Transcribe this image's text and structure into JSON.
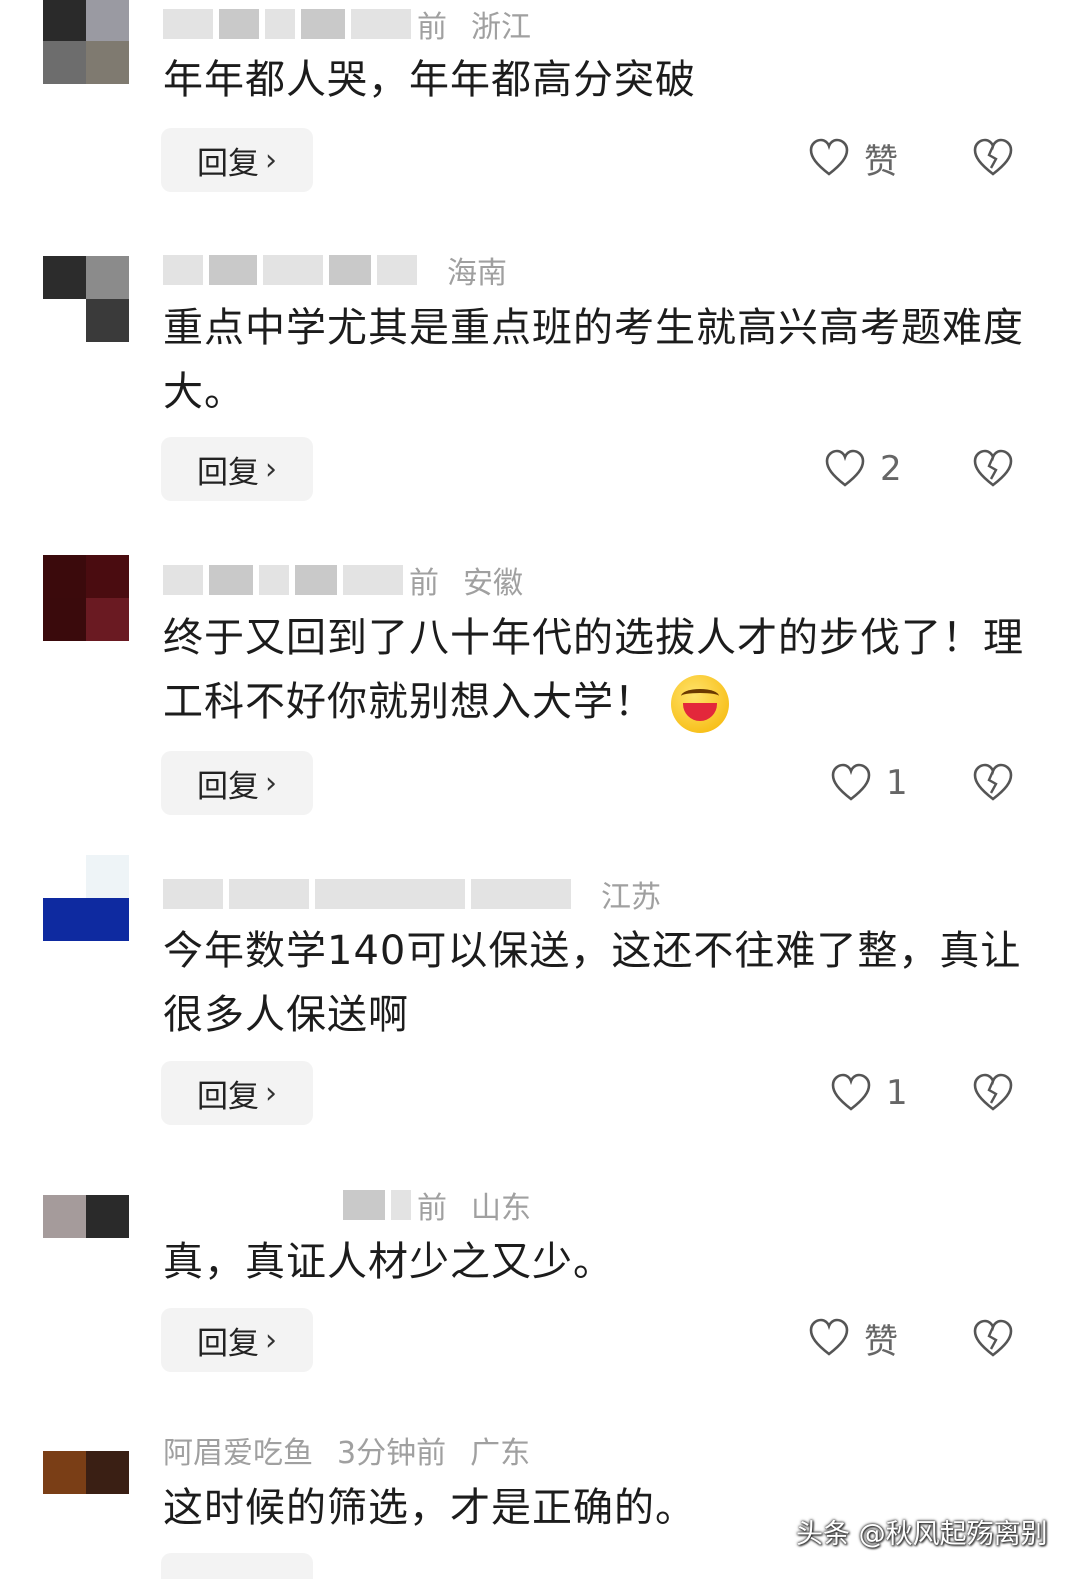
{
  "comments": [
    {
      "meta_tail": "前",
      "location": "浙江",
      "text": "年年都人哭，年年都高分突破",
      "reply_label": "回复",
      "like_label": "赞",
      "avatar_colors": [
        "#2a2a2a",
        "#9a9aa2",
        "#6d6d6d",
        "#7f7a70"
      ]
    },
    {
      "meta_tail": "",
      "location": "海南",
      "text": "重点中学尤其是重点班的考生就高兴高考题难度大。",
      "reply_label": "回复",
      "like_label": "2",
      "avatar_colors": [
        "#2c2c2c",
        "#8b8b8b",
        "#ffffff",
        "#3a3a3a"
      ]
    },
    {
      "meta_tail": "前",
      "location": "安徽",
      "text": "终于又回到了八十年代的选拔人才的步伐了！理工科不好你就别想入大学！",
      "reply_label": "回复",
      "like_label": "1",
      "avatar_colors": [
        "#3b0a0c",
        "#4a0c10",
        "#3a0a0c",
        "#6a1a22"
      ]
    },
    {
      "meta_tail": "",
      "location": "江苏",
      "text": "今年数学140可以保送，这还不往难了整，真让很多人保送啊",
      "reply_label": "回复",
      "like_label": "1",
      "avatar_colors": [
        "#ffffff",
        "#eef4f7",
        "#0e2aa0",
        "#0e2aa0"
      ]
    },
    {
      "meta_tail": "前",
      "location": "山东",
      "text": "真，真证人材少之又少。",
      "reply_label": "回复",
      "like_label": "赞",
      "avatar_colors": [
        "#a59b9b",
        "#2a2a2a",
        "#ffffff",
        "#ffffff"
      ]
    },
    {
      "username": "阿眉爱吃鱼",
      "time": "3分钟前",
      "location": "广东",
      "text": "这时候的筛选，才是正确的。",
      "avatar_colors": [
        "#7a3e16",
        "#3a1f14",
        "#ffffff",
        "#ffffff"
      ]
    }
  ],
  "watermark": "头条 @秋风起殇离别"
}
